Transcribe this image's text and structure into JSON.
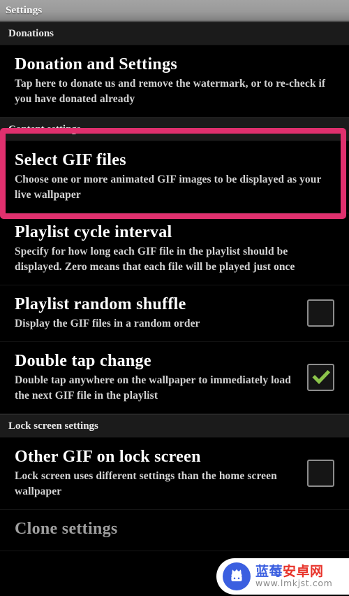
{
  "window": {
    "title": "Settings"
  },
  "sections": [
    {
      "header": "Donations",
      "rows": [
        {
          "title": "Donation and Settings",
          "summary": "Tap here to donate us and remove the watermark, or to re-check if you have donated already",
          "control": "none"
        }
      ]
    },
    {
      "header": "Content settings",
      "rows": [
        {
          "title": "Select GIF files",
          "summary": "Choose one or more animated GIF images to be displayed as your live wallpaper",
          "control": "none"
        },
        {
          "title": "Playlist cycle interval",
          "summary": "Specify for how long each GIF file in the playlist should be displayed. Zero means that each file will be played just once",
          "control": "none"
        },
        {
          "title": "Playlist random shuffle",
          "summary": "Display the GIF files in a random order",
          "control": "checkbox",
          "checked": false
        },
        {
          "title": "Double tap change",
          "summary": "Double tap anywhere on the wallpaper to immediately load the next GIF file in the playlist",
          "control": "checkbox",
          "checked": true
        }
      ]
    },
    {
      "header": "Lock screen settings",
      "rows": [
        {
          "title": "Other GIF on lock screen",
          "summary": "Lock screen uses different settings than the home screen wallpaper",
          "control": "checkbox",
          "checked": false
        },
        {
          "title": "Clone settings",
          "summary": "",
          "control": "none",
          "dimmed": true
        }
      ]
    }
  ],
  "highlight": {
    "target": "Select GIF files",
    "color": "#e0306e"
  },
  "watermark": {
    "brand_part1": "蓝莓",
    "brand_part2": "安卓网",
    "url": "www.lmkjst.com",
    "logo_icon": "android-robot-crown-icon",
    "logo_color": "#3b5fe0",
    "accent_color": "#e8342b"
  },
  "colors": {
    "checked_mark": "#8bc34a",
    "checkbox_border": "#8d8d8d",
    "background": "#000000",
    "section_header_bg": "#1b1b1b"
  }
}
